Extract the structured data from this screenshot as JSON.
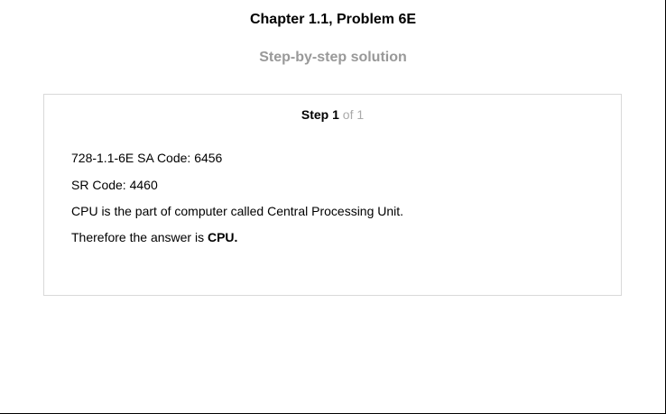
{
  "header": {
    "title": "Chapter 1.1, Problem 6E",
    "subtitle": "Step-by-step solution"
  },
  "step": {
    "label": "Step",
    "number": "1",
    "of_text": "of 1",
    "lines": {
      "line1": "728-1.1-6E SA Code: 6456",
      "line2": "SR Code: 4460",
      "line3": "CPU is the part of computer called Central Processing Unit.",
      "line4_prefix": "Therefore the answer is",
      "line4_answer": "CPU."
    }
  }
}
